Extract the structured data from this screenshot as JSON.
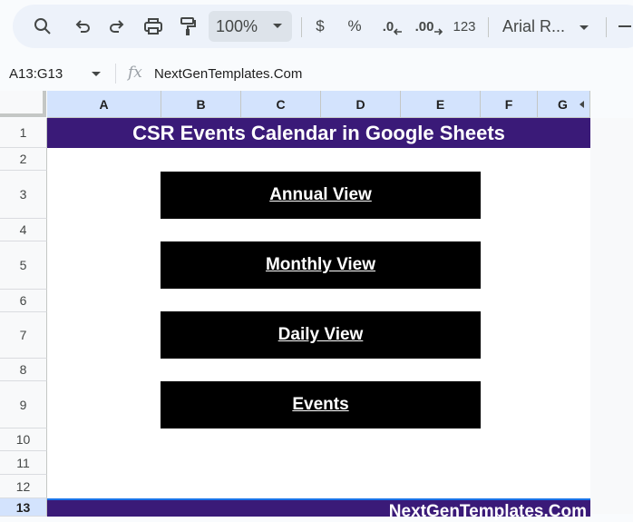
{
  "toolbar": {
    "zoom": "100%",
    "currency": "$",
    "percent": "%",
    "dec_decrease": ".0",
    "dec_increase": ".00",
    "number_format": "123",
    "font": "Arial R..."
  },
  "formula_bar": {
    "name_box": "A13:G13",
    "fx": "fx",
    "content": "NextGenTemplates.Com"
  },
  "columns": [
    "A",
    "B",
    "C",
    "D",
    "E",
    "F",
    "G"
  ],
  "rows": [
    "1",
    "2",
    "3",
    "4",
    "5",
    "6",
    "7",
    "8",
    "9",
    "10",
    "11",
    "12",
    "13"
  ],
  "sheet": {
    "title": "CSR Events Calendar in Google Sheets",
    "buttons": [
      "Annual View",
      "Monthly View",
      "Daily View",
      "Events"
    ],
    "footer": "NextGenTemplates.Com"
  },
  "colors": {
    "title_bg": "#3a1a78",
    "button_bg": "#000000",
    "selected_header": "#d3e3fd"
  }
}
